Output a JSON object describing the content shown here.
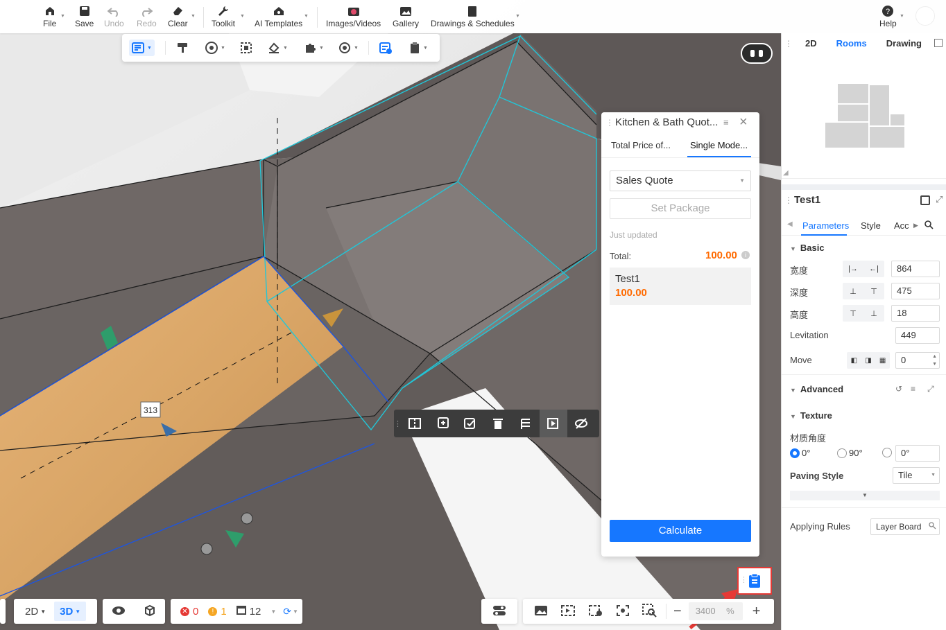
{
  "toolbar": {
    "file": "File",
    "save": "Save",
    "undo": "Undo",
    "redo": "Redo",
    "clear": "Clear",
    "toolkit": "Toolkit",
    "ai_templates": "AI Templates",
    "images_videos": "Images/Videos",
    "gallery": "Gallery",
    "drawings": "Drawings & Schedules",
    "help": "Help"
  },
  "viewport": {
    "dimension_label": "313"
  },
  "quote_panel": {
    "title": "Kitchen & Bath Quot...",
    "tabs": [
      "Total Price of...",
      "Single Mode..."
    ],
    "active_tab": 1,
    "select_value": "Sales Quote",
    "set_package": "Set Package",
    "status": "Just updated",
    "total_label": "Total:",
    "total_value": "100.00",
    "item_name": "Test1",
    "item_price": "100.00",
    "calculate": "Calculate"
  },
  "right_panel": {
    "tabs": [
      "2D",
      "Rooms",
      "Drawing"
    ],
    "active_tab": "Rooms",
    "object_name": "Test1",
    "prop_tabs": [
      "Parameters",
      "Style",
      "Acc"
    ],
    "basic": "Basic",
    "width_label": "宽度",
    "width": "864",
    "depth_label": "深度",
    "depth": "475",
    "height_label": "高度",
    "height": "18",
    "levitation_label": "Levitation",
    "levitation": "449",
    "move_label": "Move",
    "move": "0",
    "advanced": "Advanced",
    "texture": "Texture",
    "material_angle_label": "材质角度",
    "angle_options": [
      "0°",
      "90°"
    ],
    "angle_custom": "0°",
    "paving_style_label": "Paving Style",
    "paving_style": "Tile",
    "applying_rules_label": "Applying Rules",
    "applying_rules": "Layer Board"
  },
  "bottom": {
    "view_2d": "2D",
    "view_3d": "3D",
    "errors": "0",
    "warnings": "1",
    "items": "12",
    "zoom": "3400",
    "zoom_unit": "%"
  },
  "colors": {
    "accent": "#1677ff",
    "price": "#ff6a00",
    "highlight": "#e53935"
  }
}
